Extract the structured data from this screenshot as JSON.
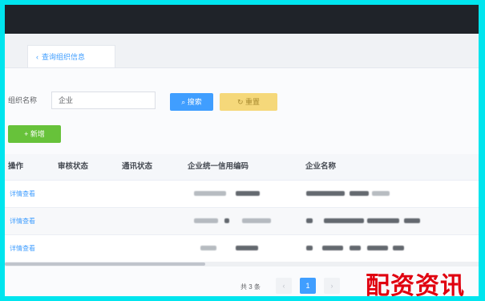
{
  "colors": {
    "accent": "#409eff",
    "topbar": "#1f2329",
    "success": "#67c23a",
    "warning": "#f5d87a",
    "watermark": "#e0000f"
  },
  "tabs": {
    "active_label": "查询组织信息",
    "chevron_icon": "chevron-left-icon"
  },
  "search": {
    "label": "组织名称",
    "value": "企业"
  },
  "toolbar": {
    "query_label": "搜索",
    "reset_label": "重置",
    "add_label": "新增"
  },
  "table": {
    "headers": [
      "操作",
      "审核状态",
      "通讯状态",
      "企业统一信用编码",
      "企业名称"
    ],
    "rows": [
      {
        "action": "详情查看"
      },
      {
        "action": "详情查看"
      },
      {
        "action": "详情查看"
      }
    ]
  },
  "pagination": {
    "summary": "共 3 条",
    "current_page": "1"
  },
  "watermark": {
    "text": "配资资讯"
  }
}
